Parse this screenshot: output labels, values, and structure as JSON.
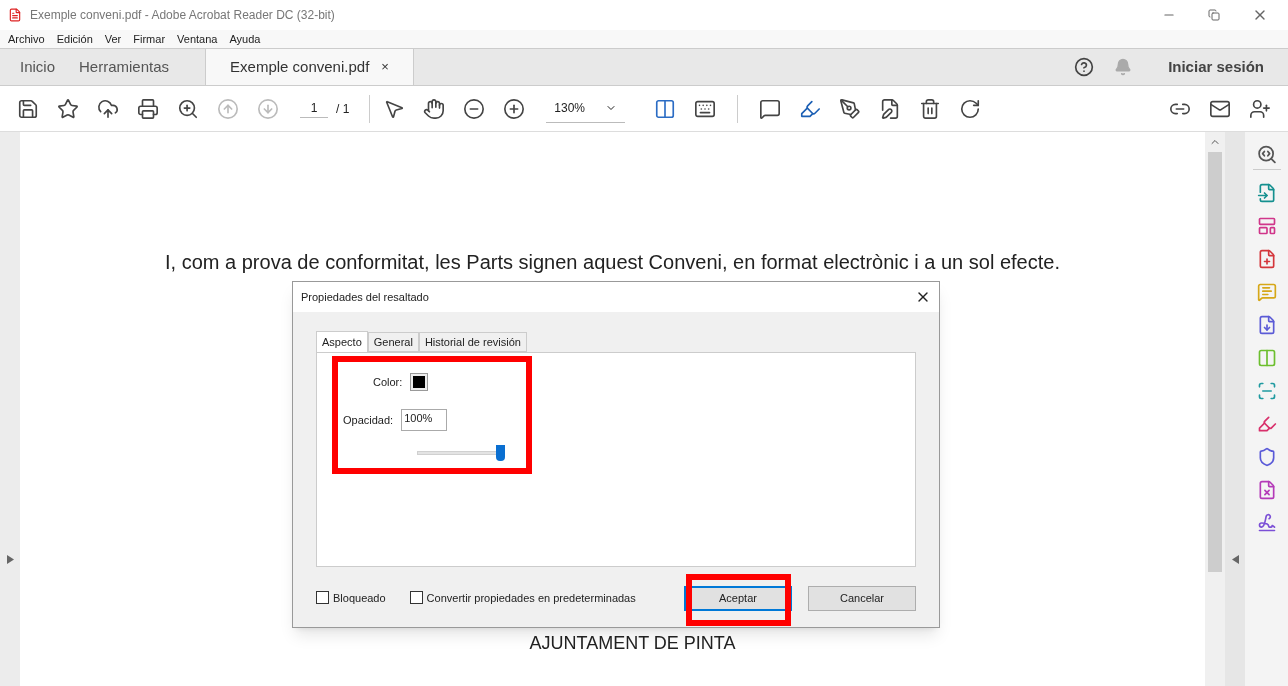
{
  "window": {
    "title": "Exemple conveni.pdf - Adobe Acrobat Reader DC (32-bit)"
  },
  "menu": [
    "Archivo",
    "Edición",
    "Ver",
    "Firmar",
    "Ventana",
    "Ayuda"
  ],
  "tabs": [
    {
      "label": "Inicio",
      "selected": false
    },
    {
      "label": "Herramientas",
      "selected": false
    },
    {
      "label": "Exemple conveni.pdf",
      "selected": true,
      "close_label": "×"
    }
  ],
  "sign_in": "Iniciar sesión",
  "toolbar": {
    "page_nav": [
      {
        "disabled": true
      },
      {
        "disabled": true
      }
    ],
    "page_current": "1",
    "page_total": "/ 1",
    "zoom": "130%"
  },
  "document": {
    "paragraphs": [
      "I, com a prova de conformitat, les Parts signen aquest Conveni, en format electrònic i a un sol efecte.",
      "AJUNTAMENT DE PINTA"
    ]
  },
  "dialog": {
    "title": "Propiedades del resaltado",
    "tabs": [
      {
        "label": "Aspecto",
        "selected": true
      },
      {
        "label": "General",
        "selected": false
      },
      {
        "label": "Historial de revisión",
        "selected": false
      }
    ],
    "color_label": "Color:",
    "color": "#000000",
    "opacity_label": "Opacidad:",
    "opacity_value": "100%",
    "opacity_slider": {
      "level": 1
    },
    "checkboxes": [
      {
        "label": "Bloqueado",
        "checked": false
      },
      {
        "label": "Convertir propiedades en predeterminadas",
        "checked": false
      }
    ],
    "buttons": [
      {
        "label": "Aceptar",
        "default": true
      },
      {
        "label": "Cancelar",
        "default": false
      }
    ]
  },
  "right_tools": [
    {
      "color": "#14908f"
    },
    {
      "color": "#d0368a"
    },
    {
      "color": "#d4363b"
    },
    {
      "color": "#d6a718"
    },
    {
      "color": "#5b5bd6"
    },
    {
      "color": "#6cbf2e"
    },
    {
      "color": "#1f9aa0"
    },
    {
      "color": "#d8306b"
    },
    {
      "color": "#5a5ad8"
    },
    {
      "color": "#b43ab8"
    },
    {
      "color": "#7b4fd6"
    }
  ]
}
